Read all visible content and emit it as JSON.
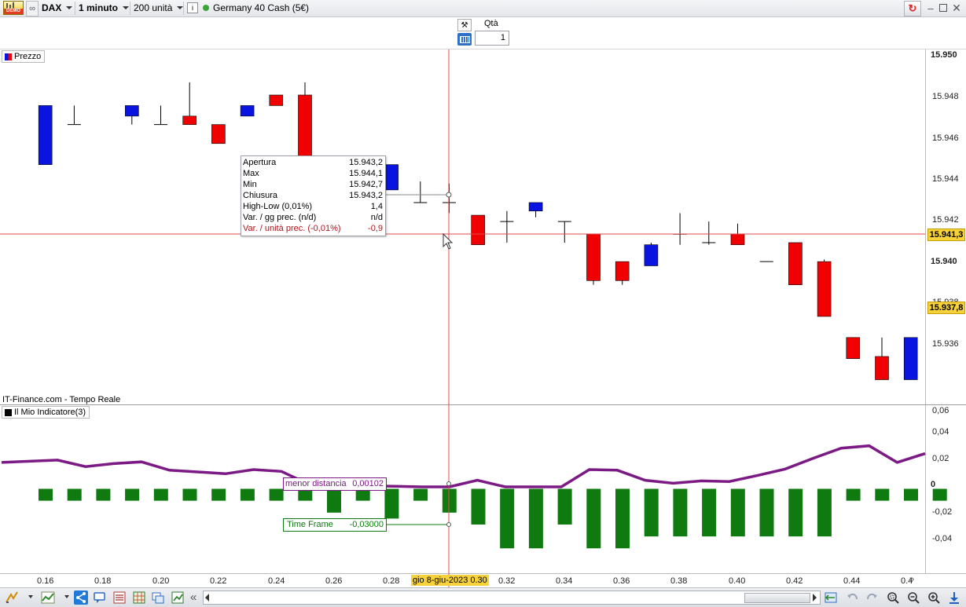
{
  "toolbar": {
    "demo_badge": "DEMO",
    "instrument": "DAX",
    "timeframe": "1 minuto",
    "units": "200 unità",
    "info_icon": "i",
    "market_name": "Germany 40 Cash (5€)"
  },
  "order": {
    "qty_label": "Qtà",
    "qty_value": "1"
  },
  "price_panel": {
    "label": "Prezzo",
    "source": "IT-Finance.com - Tempo Reale",
    "y_ticks": [
      "15.950",
      "15.948",
      "15.946",
      "15.944",
      "15.942",
      "15.940",
      "15.938",
      "15.936"
    ],
    "current_price": "15.941,3",
    "last_price": "15.937,8",
    "colors": {
      "up": "#0a14e0",
      "down": "#f00000",
      "flat": "#000000"
    }
  },
  "tooltip": {
    "rows": [
      {
        "label": "Apertura",
        "value": "15.943,2"
      },
      {
        "label": "Max",
        "value": "15.944,1"
      },
      {
        "label": "Min",
        "value": "15.942,7"
      },
      {
        "label": "Chiusura",
        "value": "15.943,2"
      },
      {
        "label": "High-Low (0,01%)",
        "value": "1,4"
      },
      {
        "label": "Var. / gg prec. (n/d)",
        "value": "n/d"
      },
      {
        "label": "Var. / unità prec. (-0,01%)",
        "value": "-0,9"
      }
    ]
  },
  "indicator_panel": {
    "label": "Il Mio Indicatore(3)",
    "y_ticks": [
      "0,06",
      "0,04",
      "0,02",
      "0",
      "-0,02",
      "-0,04"
    ],
    "label_distance": "menor distancia",
    "value_distance": "0,00102",
    "label_timeframe": "Time Frame",
    "value_timeframe": "-0,03000",
    "colors": {
      "line": "#7b1a84",
      "bars": "#0f7a10"
    }
  },
  "x_axis": {
    "ticks": [
      "0.16",
      "0.18",
      "0.20",
      "0.22",
      "0.24",
      "0.26",
      "0.28",
      "0.32",
      "0.34",
      "0.36",
      "0.38",
      "0.40",
      "0.42",
      "0.44",
      "0.4"
    ],
    "cursor_label": "gio 8-giu-2023 0.30"
  },
  "chart_data": {
    "type": "candlestick",
    "x": [
      "0.15",
      "0.16",
      "0.17",
      "0.18",
      "0.19",
      "0.20",
      "0.21",
      "0.22",
      "0.23",
      "0.24",
      "0.25",
      "0.26",
      "0.27",
      "0.28",
      "0.29",
      "0.30",
      "0.31",
      "0.32",
      "0.33",
      "0.34",
      "0.35",
      "0.36",
      "0.37",
      "0.38",
      "0.39",
      "0.40",
      "0.41",
      "0.42",
      "0.43",
      "0.44",
      "0.45",
      "0.46"
    ],
    "ohlc": [
      null,
      [
        15945.0,
        15947.8,
        15945.0,
        15947.8
      ],
      [
        15946.9,
        15947.8,
        15946.9,
        15946.9
      ],
      null,
      [
        15947.3,
        15947.8,
        15946.9,
        15947.8
      ],
      [
        15946.9,
        15947.8,
        15946.9,
        15946.9
      ],
      [
        15947.3,
        15948.9,
        15946.9,
        15946.9
      ],
      [
        15946.9,
        15946.9,
        15946.0,
        15946.0
      ],
      [
        15947.3,
        15947.8,
        15947.3,
        15947.8
      ],
      [
        15948.3,
        15948.3,
        15947.8,
        15947.8
      ],
      [
        15948.3,
        15948.9,
        15945.3,
        15945.3
      ],
      null,
      null,
      [
        15943.8,
        15945.0,
        15943.8,
        15945.0
      ],
      [
        15943.2,
        15944.2,
        15943.2,
        15943.2
      ],
      [
        15943.2,
        15944.1,
        15942.7,
        15943.2
      ],
      [
        15942.6,
        15942.6,
        15941.2,
        15941.2
      ],
      [
        15942.3,
        15942.8,
        15941.3,
        15942.3
      ],
      [
        15942.8,
        15943.2,
        15942.5,
        15943.2
      ],
      [
        15942.3,
        15942.3,
        15941.3,
        15942.3
      ],
      [
        15941.7,
        15941.7,
        15939.3,
        15939.5
      ],
      [
        15940.4,
        15940.4,
        15939.3,
        15939.5
      ],
      [
        15940.2,
        15941.3,
        15940.2,
        15941.2
      ],
      [
        15941.7,
        15942.7,
        15941.2,
        15941.7
      ],
      [
        15941.3,
        15942.3,
        15941.2,
        15941.3
      ],
      [
        15941.7,
        15942.2,
        15941.2,
        15941.2
      ],
      [
        15940.4,
        15940.4,
        15940.4,
        15940.4
      ],
      [
        15941.3,
        15941.3,
        15939.3,
        15939.3
      ],
      [
        15940.4,
        15940.5,
        15937.8,
        15937.8
      ],
      [
        15936.8,
        15936.8,
        15935.8,
        15935.8
      ],
      [
        15935.9,
        15936.8,
        15934.8,
        15934.8
      ],
      [
        15934.8,
        15936.8,
        15934.8,
        15936.8
      ]
    ],
    "y_range": [
      15934.0,
      15950.2
    ],
    "indicator_line": [
      0.0215,
      0.0225,
      0.0235,
      0.018,
      0.0205,
      0.022,
      0.015,
      0.0135,
      0.012,
      0.0155,
      0.014,
      0.003,
      0.004,
      0.002,
      0.0015,
      0.001,
      0.001,
      0.0065,
      0.001,
      0.001,
      0.001,
      0.0155,
      0.015,
      0.0065,
      0.004,
      0.006,
      0.0055,
      0.0105,
      0.016,
      0.025,
      0.0335,
      0.0355,
      0.0215,
      0.029
    ],
    "indicator_bars": [
      -0.01,
      -0.01,
      -0.01,
      -0.01,
      -0.01,
      -0.01,
      -0.01,
      -0.01,
      -0.01,
      -0.01,
      -0.02,
      -0.01,
      -0.025,
      -0.01,
      -0.02,
      -0.03,
      -0.05,
      -0.05,
      -0.03,
      -0.05,
      -0.05,
      -0.04,
      -0.04,
      -0.04,
      -0.04,
      -0.04,
      -0.04,
      -0.04,
      -0.01,
      -0.01,
      -0.01,
      -0.01
    ],
    "indicator_range": [
      -0.065,
      0.065
    ]
  }
}
